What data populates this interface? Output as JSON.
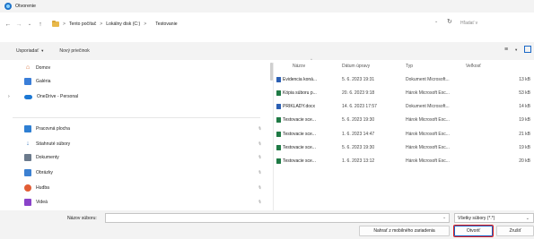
{
  "window": {
    "title": "Otvorenie"
  },
  "navigation": {
    "back_icon": "arrow-left-icon",
    "forward_icon": "arrow-right-icon",
    "recent_icon": "chevron-down-icon",
    "up_icon": "arrow-up-icon"
  },
  "address": {
    "breadcrumbs": [
      "Tento počítač",
      "Lokálny disk (C:)",
      "Testovanie"
    ],
    "separator": ">",
    "search_placeholder": "Hľadať v"
  },
  "toolbar": {
    "organize_label": "Usporiadať",
    "new_folder_label": "Nový priečinok"
  },
  "sidebar": {
    "items": [
      {
        "label": "Domov",
        "icon": "home-icon"
      },
      {
        "label": "Galéria",
        "icon": "gallery-icon"
      },
      {
        "label": "OneDrive - Personal",
        "icon": "cloud-icon"
      },
      {
        "label": "Pracovná plocha",
        "icon": "desktop-icon"
      },
      {
        "label": "Stiahnuté súbory",
        "icon": "download-icon"
      },
      {
        "label": "Dokumenty",
        "icon": "documents-icon"
      },
      {
        "label": "Obrázky",
        "icon": "pictures-icon"
      },
      {
        "label": "Hudba",
        "icon": "music-icon"
      },
      {
        "label": "Videá",
        "icon": "videos-icon"
      }
    ]
  },
  "files": {
    "columns": {
      "name": "Názov",
      "date": "Dátum úpravy",
      "type": "Typ",
      "size": "Veľkosť"
    },
    "rows": [
      {
        "name": "Evidencia koná...",
        "date": "5. 6. 2023 19:31",
        "type": "Dokument Microsoft...",
        "size": "13 kB",
        "kind": "word"
      },
      {
        "name": "Kópia súboru p...",
        "date": "20. 6. 2023 9:18",
        "type": "Hárok Microsoft Exc...",
        "size": "53 kB",
        "kind": "excel"
      },
      {
        "name": "PRIKLADY.docx",
        "date": "14. 6. 2023 17:57",
        "type": "Dokument Microsoft...",
        "size": "14 kB",
        "kind": "word"
      },
      {
        "name": "Testovacie sce...",
        "date": "5. 6. 2023 19:30",
        "type": "Hárok Microsoft Exc...",
        "size": "19 kB",
        "kind": "excel"
      },
      {
        "name": "Testovacie sce...",
        "date": "1. 6. 2023 14:47",
        "type": "Hárok Microsoft Exc...",
        "size": "21 kB",
        "kind": "excel"
      },
      {
        "name": "Testovacie sce...",
        "date": "5. 6. 2023 19:30",
        "type": "Hárok Microsoft Exc...",
        "size": "19 kB",
        "kind": "excel"
      },
      {
        "name": "Testovacie sce...",
        "date": "1. 6. 2023 13:12",
        "type": "Hárok Microsoft Exc...",
        "size": "20 kB",
        "kind": "excel"
      }
    ]
  },
  "footer": {
    "filename_label": "Názov súboru:",
    "filename_value": "",
    "filetype_value": "Všetky súbory (*.*)",
    "mobile_button": "Nahrať z mobilného zariadenia",
    "open_button": "Otvoriť",
    "cancel_button": "Zrušiť"
  }
}
